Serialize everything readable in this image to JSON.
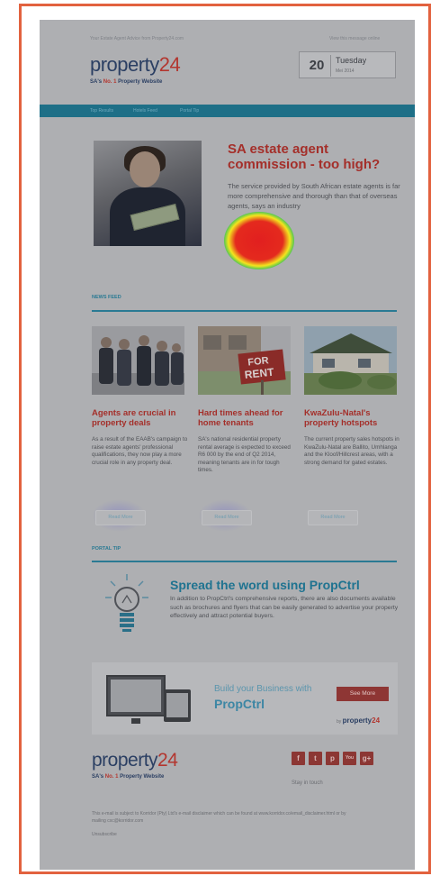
{
  "header": {
    "left_note": "Your Estate Agent Advice from Property24.com",
    "right_note": "View this message online",
    "logo_word": "property",
    "logo_num": "24",
    "tagline_pre": "SA's ",
    "tagline_num": "No. 1",
    "tagline_post": " Property Website",
    "date_day": "20",
    "date_weekday": "Tuesday",
    "date_monthyear": "Mei 2014"
  },
  "nav": {
    "items": [
      "Top Results",
      "Hotels Feed",
      "Portal Tip"
    ]
  },
  "hero": {
    "title": "SA estate agent commission - too high?",
    "text": "The service provided by South African estate agents is far more comprehensive and thorough than that of overseas agents, says an industry"
  },
  "news_feed": {
    "label": "NEWS FEED",
    "articles": [
      {
        "title": "Agents are crucial in property deals",
        "text": "As a result of the EAAB's campaign to raise estate agents' professional qualifications, they now play a more crucial role in any property deal.",
        "cta": "Read More"
      },
      {
        "title": "Hard times ahead for home tenants",
        "text": "SA's national residential property rental average is expected to exceed R6 000 by the end of Q2 2014, meaning tenants are in for tough times.",
        "cta": "Read More",
        "sign_text_1": "FOR",
        "sign_text_2": "RENT"
      },
      {
        "title": "KwaZulu-Natal's property hotspots",
        "text": "The current property sales hotspots in KwaZulu-Natal are Ballito, Umhlanga and the Kloof/Hillcrest areas, with a strong demand for gated estates.",
        "cta": "Read More"
      }
    ]
  },
  "portal_tip": {
    "label": "PORTAL TIP",
    "title": "Spread the word using PropCtrl",
    "text": "In addition to PropCtrl's comprehensive reports, there are also documents available such as brochures and flyers that can be easily generated to advertise your property effectively and attract potential buyers."
  },
  "banner": {
    "line1": "Build your Business with",
    "line2": "PropCtrl",
    "cta": "See More",
    "by": "by",
    "brand_word": "property",
    "brand_num": "24"
  },
  "footer": {
    "logo_word": "property",
    "logo_num": "24",
    "tagline_pre": "SA's ",
    "tagline_num": "No. 1",
    "tagline_post": " Property Website",
    "social": [
      "f",
      "t",
      "p",
      "You",
      "g+"
    ],
    "stay": "Stay in touch",
    "disclaimer": "This e-mail is subject to Korridor (Pty) Ltd's e-mail disclaimer which can be found at www.korridor.co/email_disclaimer.html or by mailing cxc@korridor.com",
    "unsubscribe": "Unsubscribe"
  },
  "colors": {
    "accent_red": "#a42f2a",
    "accent_teal": "#2a7a93",
    "frame": "#e2623f"
  }
}
